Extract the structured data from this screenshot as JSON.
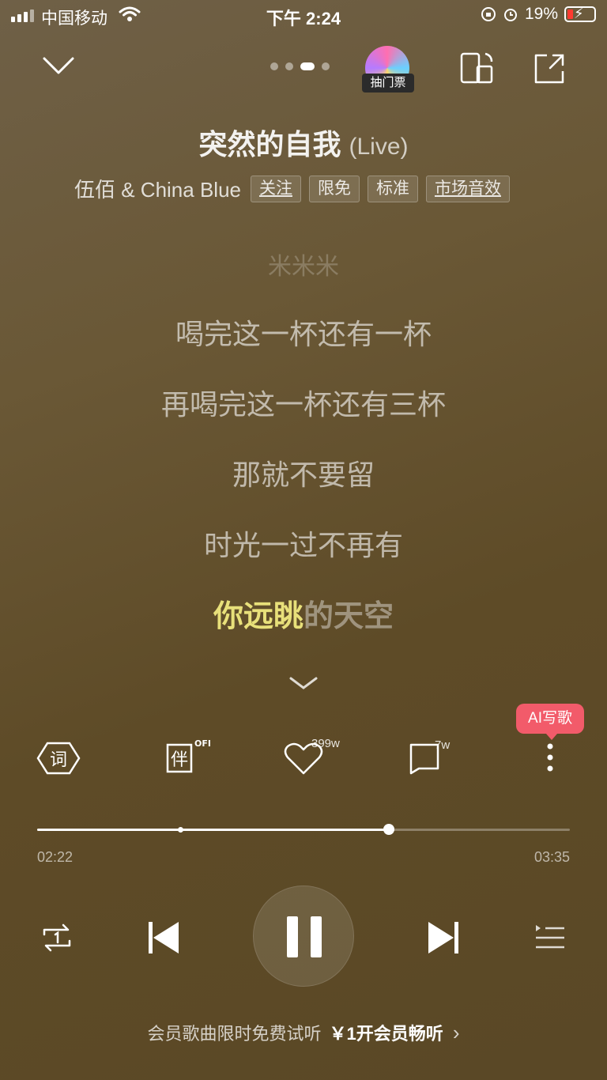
{
  "status_bar": {
    "carrier": "中国移动",
    "time": "下午 2:24",
    "battery": "19%"
  },
  "header": {
    "page_dots": 4,
    "active_dot": 2,
    "ticket_label": "抽门票"
  },
  "song": {
    "title": "突然的自我",
    "version": "(Live)",
    "artist": "伍佰 & China Blue",
    "tags": [
      "关注",
      "限免",
      "标准",
      "市场音效"
    ]
  },
  "lyrics": {
    "prev": "米米米",
    "lines": [
      "喝完这一杯还有一杯",
      "再喝完这一杯还有三杯",
      "那就不要留",
      "时光一过不再有"
    ],
    "current_sung": "你远眺",
    "current_rest": "的天空"
  },
  "actions": {
    "ai_badge": "AI写歌",
    "lyrics_icon_label": "词",
    "accompany_label": "伴",
    "accompany_state": "OFF",
    "like_count": "399w",
    "comment_count": "7w"
  },
  "progress": {
    "current": "02:22",
    "total": "03:35",
    "fraction": 0.66
  },
  "promo": {
    "text": "会员歌曲限时免费试听",
    "cta": "￥1开会员畅听",
    "arrow": "›"
  },
  "colors": {
    "highlight": "#e8e07a",
    "badge": "#f25b6a"
  }
}
